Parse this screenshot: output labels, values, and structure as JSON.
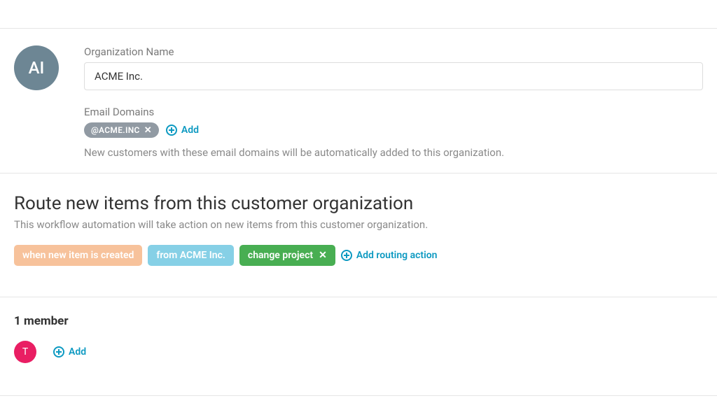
{
  "org": {
    "avatar_initials": "AI",
    "name_label": "Organization Name",
    "name_value": "ACME Inc.",
    "domains_label": "Email Domains",
    "domain_chip": "@ACME.INC",
    "add_domain": "Add",
    "domain_helper": "New customers with these email domains will be automatically added to this organization."
  },
  "route": {
    "title": "Route new items from this customer organization",
    "subtitle": "This workflow automation will take action on new items from this customer organization.",
    "pills": {
      "trigger": "when new item is created",
      "condition": "from ACME Inc.",
      "action": "change project"
    },
    "add_action": "Add routing action"
  },
  "members": {
    "count_label": "1 member",
    "avatar_initial": "T",
    "add_label": "Add"
  }
}
